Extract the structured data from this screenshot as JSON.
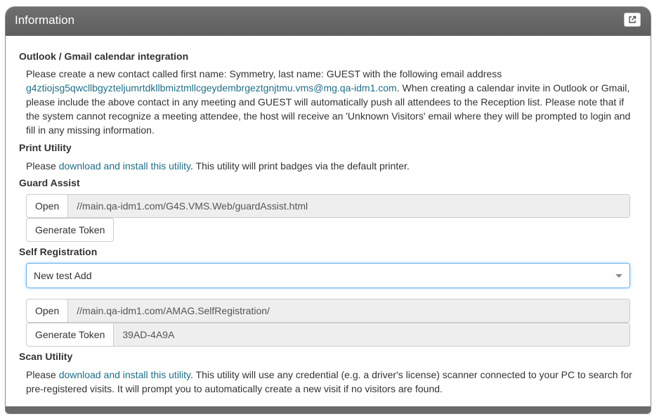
{
  "panel": {
    "title": "Information"
  },
  "outlook": {
    "heading": "Outlook / Gmail calendar integration",
    "text_before_email": "Please create a new contact called first name: Symmetry, last name: GUEST with the following email address",
    "email": "g4ztiojsg5qwcllbgyzteljumrtdkllbmiztmllcgeydembrgeztgnjtmu.vms@mg.qa-idm1.com",
    "text_after_email": ". When creating a calendar invite in Outlook or Gmail, please include the above contact in any meeting and GUEST will automatically push all attendees to the Reception list. Please note that if the system cannot recognize a meeting attendee, the host will receive an 'Unknown Visitors' email where they will be prompted to login and fill in any missing information."
  },
  "print_utility": {
    "heading": "Print Utility",
    "prefix": "Please ",
    "link": "download and install this utility",
    "suffix": ". This utility will print badges via the default printer."
  },
  "guard_assist": {
    "heading": "Guard Assist",
    "open_label": "Open",
    "url": "//main.qa-idm1.com/G4S.VMS.Web/guardAssist.html",
    "generate_label": "Generate Token"
  },
  "self_registration": {
    "heading": "Self Registration",
    "selected": "New test Add",
    "open_label": "Open",
    "url": "//main.qa-idm1.com/AMAG.SelfRegistration/",
    "generate_label": "Generate Token",
    "token": "39AD-4A9A"
  },
  "scan_utility": {
    "heading": "Scan Utility",
    "prefix": "Please ",
    "link": "download and install this utility",
    "suffix": ". This utility will use any credential (e.g. a driver's license) scanner connected to your PC to search for pre-registered visits. It will prompt you to automatically create a new visit if no visitors are found."
  },
  "colors": {
    "header_bg": "#666666",
    "link": "#1f6e85",
    "focus_border": "#66afe9"
  },
  "icons": {
    "popout": "external-link-icon",
    "dropdown": "caret-down-icon"
  }
}
